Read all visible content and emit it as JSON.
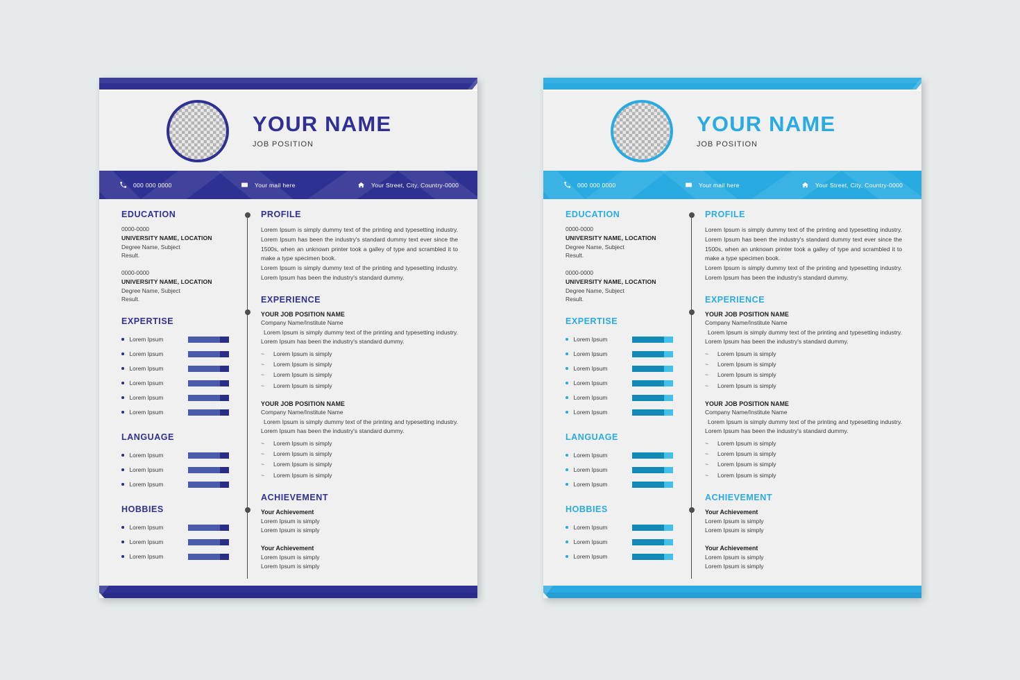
{
  "background_color": "#e4ebea",
  "resumes": [
    {
      "variant": "blue",
      "accent_color": "#2e3192",
      "bar_color_a": "#4a5bab",
      "bar_color_b": "#2a2d87"
    },
    {
      "variant": "teal",
      "accent_color": "#29abe2",
      "bar_color_a": "#1389b8",
      "bar_color_b": "#41c0e8"
    }
  ],
  "header": {
    "name": "YOUR NAME",
    "job_position": "JOB POSITION",
    "avatar_alt": "photo-placeholder"
  },
  "contact": {
    "phone_icon": "phone-icon",
    "phone": "000 000 0000",
    "mail_icon": "envelope-icon",
    "mail": "Your mail here",
    "address_icon": "home-icon",
    "address": "Your Street, City, Country-0000"
  },
  "left": {
    "education": {
      "heading": "EDUCATION",
      "entries": [
        {
          "date": "0000-0000",
          "university": "UNIVERSITY NAME, LOCATION",
          "degree": "Degree Name, Subject",
          "result": "Result."
        },
        {
          "date": "0000-0000",
          "university": "UNIVERSITY NAME, LOCATION",
          "degree": "Degree Name, Subject",
          "result": "Result."
        }
      ]
    },
    "expertise": {
      "heading": "EXPERTISE",
      "items": [
        {
          "label": "Lorem Ipsum",
          "level": 78
        },
        {
          "label": "Lorem Ipsum",
          "level": 78
        },
        {
          "label": "Lorem Ipsum",
          "level": 78
        },
        {
          "label": "Lorem Ipsum",
          "level": 78
        },
        {
          "label": "Lorem Ipsum",
          "level": 78
        },
        {
          "label": "Lorem Ipsum",
          "level": 78
        }
      ]
    },
    "language": {
      "heading": "LANGUAGE",
      "items": [
        {
          "label": "Lorem Ipsum",
          "level": 78
        },
        {
          "label": "Lorem Ipsum",
          "level": 78
        },
        {
          "label": "Lorem Ipsum",
          "level": 78
        }
      ]
    },
    "hobbies": {
      "heading": "HOBBIES",
      "items": [
        {
          "label": "Lorem Ipsum",
          "level": 78
        },
        {
          "label": "Lorem Ipsum",
          "level": 78
        },
        {
          "label": "Lorem Ipsum",
          "level": 78
        }
      ]
    }
  },
  "right": {
    "profile": {
      "heading": "PROFILE",
      "paragraphs": [
        "Lorem Ipsum is simply dummy text of the printing and typesetting industry. Lorem Ipsum has been the industry's standard dummy text ever since the 1500s, when an unknown printer took a galley of type and scrambled it to make a type specimen book.",
        "Lorem Ipsum is simply dummy text of the printing and typesetting industry. Lorem Ipsum has been the industry's standard dummy."
      ]
    },
    "experience": {
      "heading": "EXPERIENCE",
      "jobs": [
        {
          "title": "YOUR JOB POSITION NAME",
          "company": "Company Name/Institute Name",
          "description": "Lorem Ipsum is simply dummy text of the printing and typesetting industry. Lorem Ipsum has been the industry's standard dummy.",
          "bullet_mark": "~",
          "bullets": [
            "Lorem Ipsum is simply",
            "Lorem Ipsum is simply",
            "Lorem Ipsum is simply",
            "Lorem Ipsum is simply"
          ]
        },
        {
          "title": "YOUR JOB POSITION NAME",
          "company": "Company Name/Institute Name",
          "description": "Lorem Ipsum is simply dummy text of the printing and typesetting industry. Lorem Ipsum has been the industry's standard dummy.",
          "bullet_mark": "~",
          "bullets": [
            "Lorem Ipsum is simply",
            "Lorem Ipsum is simply",
            "Lorem Ipsum is simply",
            "Lorem Ipsum is simply"
          ]
        }
      ]
    },
    "achievement": {
      "heading": "ACHIEVEMENT",
      "groups": [
        {
          "title": "Your Achievement",
          "lines": [
            "Lorem Ipsum is simply",
            "Lorem Ipsum is simply"
          ]
        },
        {
          "title": "Your Achievement",
          "lines": [
            "Lorem Ipsum is simply",
            "Lorem Ipsum is simply"
          ]
        }
      ]
    }
  }
}
